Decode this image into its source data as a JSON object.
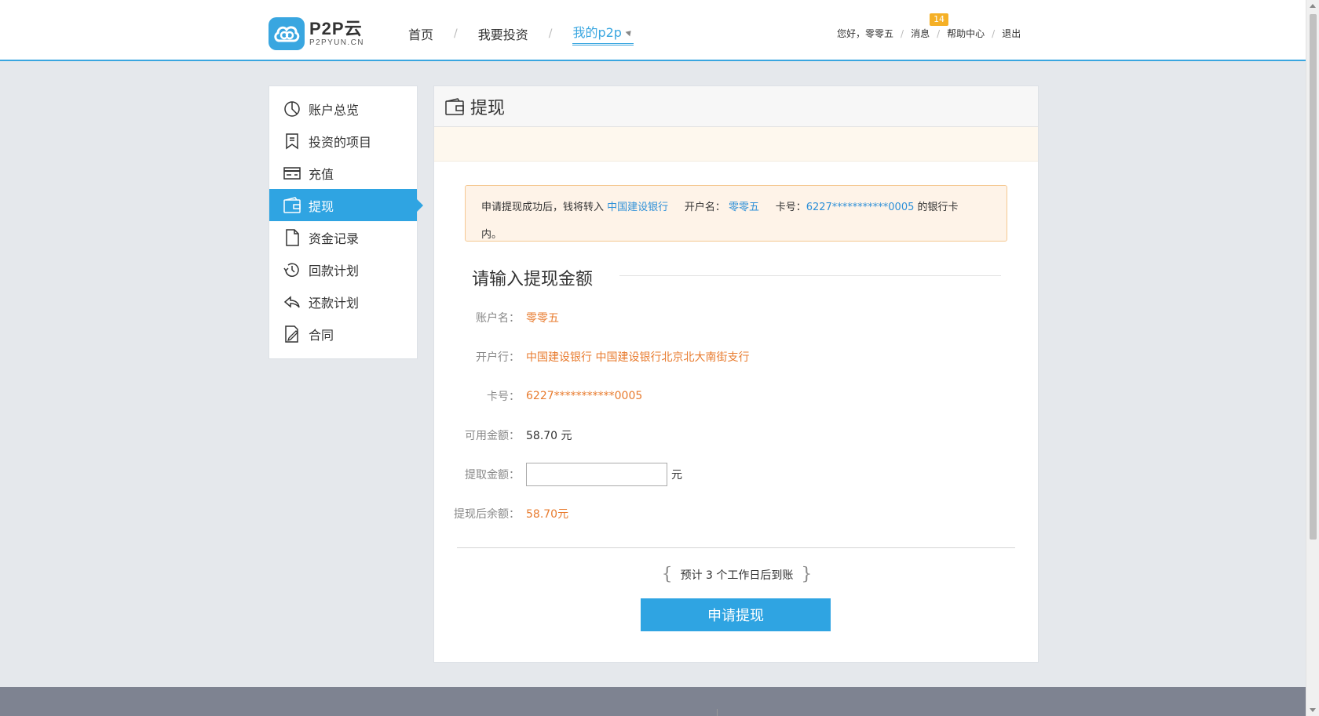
{
  "brand": {
    "name": "P2P云",
    "domain": "P2PYUN.CN",
    "accent": "#39a6e0"
  },
  "nav": {
    "items": [
      {
        "label": "首页"
      },
      {
        "label": "我要投资"
      },
      {
        "label": "我的p2p"
      }
    ],
    "separator": "/"
  },
  "userbar": {
    "greeting": "您好，零零五",
    "messages_label": "消息",
    "messages_count": "14",
    "help_label": "帮助中心",
    "logout_label": "退出",
    "separator": "/"
  },
  "sidebar": {
    "items": [
      {
        "label": "账户总览",
        "icon": "pie-chart-icon"
      },
      {
        "label": "投资的项目",
        "icon": "bookmark-icon"
      },
      {
        "label": "充值",
        "icon": "card-icon"
      },
      {
        "label": "提现",
        "icon": "wallet-icon"
      },
      {
        "label": "资金记录",
        "icon": "document-icon"
      },
      {
        "label": "回款计划",
        "icon": "history-icon"
      },
      {
        "label": "还款计划",
        "icon": "reply-icon"
      },
      {
        "label": "合同",
        "icon": "edit-document-icon"
      }
    ],
    "active_index": 3
  },
  "panel": {
    "title": "提现",
    "notice": {
      "prefix": "申请提现成功后，钱将转入",
      "bank": "中国建设银行",
      "account_label": "开户名：",
      "account_name": "零零五",
      "card_label": "卡号：",
      "card_number": "6227***********0005",
      "suffix_line1": "的银行卡",
      "suffix_line2": "内。"
    },
    "section_title": "请输入提现金额",
    "form": {
      "account_name_label": "账户名：",
      "account_name": "零零五",
      "bank_label": "开户行：",
      "bank": "中国建设银行 中国建设银行北京北大南街支行",
      "card_label": "卡号：",
      "card": "6227***********0005",
      "available_label": "可用金额：",
      "available": "58.70 元",
      "amount_label": "提取金额：",
      "amount_value": "",
      "amount_unit": "元",
      "remaining_label": "提现后余额：",
      "remaining": "58.70元"
    },
    "eta_text": "预计 3 个工作日后到账",
    "submit_label": "申请提现"
  }
}
